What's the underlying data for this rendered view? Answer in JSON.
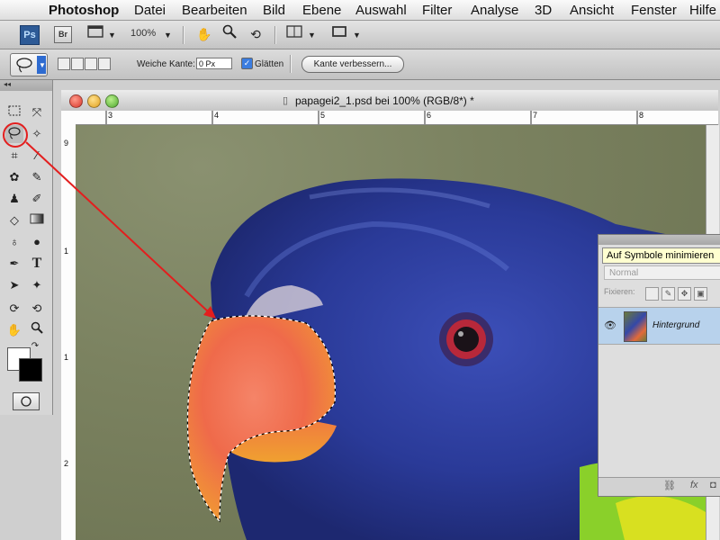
{
  "menubar": {
    "apple": "",
    "items": [
      "Photoshop",
      "Datei",
      "Bearbeiten",
      "Bild",
      "Ebene",
      "Auswahl",
      "Filter",
      "Analyse",
      "3D",
      "Ansicht",
      "Fenster",
      "Hilfe"
    ]
  },
  "appbar": {
    "logo": "Ps",
    "bridge": "Br",
    "zoom": "100%",
    "icons": [
      "screen-mode-icon",
      "hand-icon",
      "zoom-icon",
      "rotate-view-icon",
      "arrange-icon",
      "screen-layout-icon"
    ]
  },
  "options": {
    "feather_label": "Weiche Kante:",
    "feather_value": "0 Px",
    "antialias_label": "Glätten",
    "antialias_checked": true,
    "refine_button": "Kante verbessern..."
  },
  "tools": {
    "collapse": "◂◂",
    "items": [
      "marquee",
      "move",
      "lasso",
      "magic-wand",
      "crop",
      "eyedropper",
      "spot-healing",
      "brush",
      "clone-stamp",
      "history-brush",
      "eraser",
      "gradient",
      "blur",
      "dodge",
      "pen",
      "type",
      "path-selection",
      "custom-shape",
      "3d-rotate",
      "3d-orbit",
      "hand",
      "zoom"
    ],
    "active": "lasso"
  },
  "document": {
    "title": "papagei2_1.psd bei 100% (RGB/8*) *",
    "ruler_h": [
      "3",
      "4",
      "5",
      "6",
      "7",
      "8"
    ],
    "ruler_v": [
      "9",
      "1",
      "1",
      "2"
    ]
  },
  "layers_panel": {
    "tooltip": "Auf Symbole minimieren",
    "blend_mode": "Normal",
    "lock_label": "Fixieren:",
    "layer_name": "Hintergrund",
    "footer_fx": "fx"
  },
  "colors": {
    "annotation": "#e31e1e",
    "foreground": "#ffffff",
    "background": "#000000"
  }
}
